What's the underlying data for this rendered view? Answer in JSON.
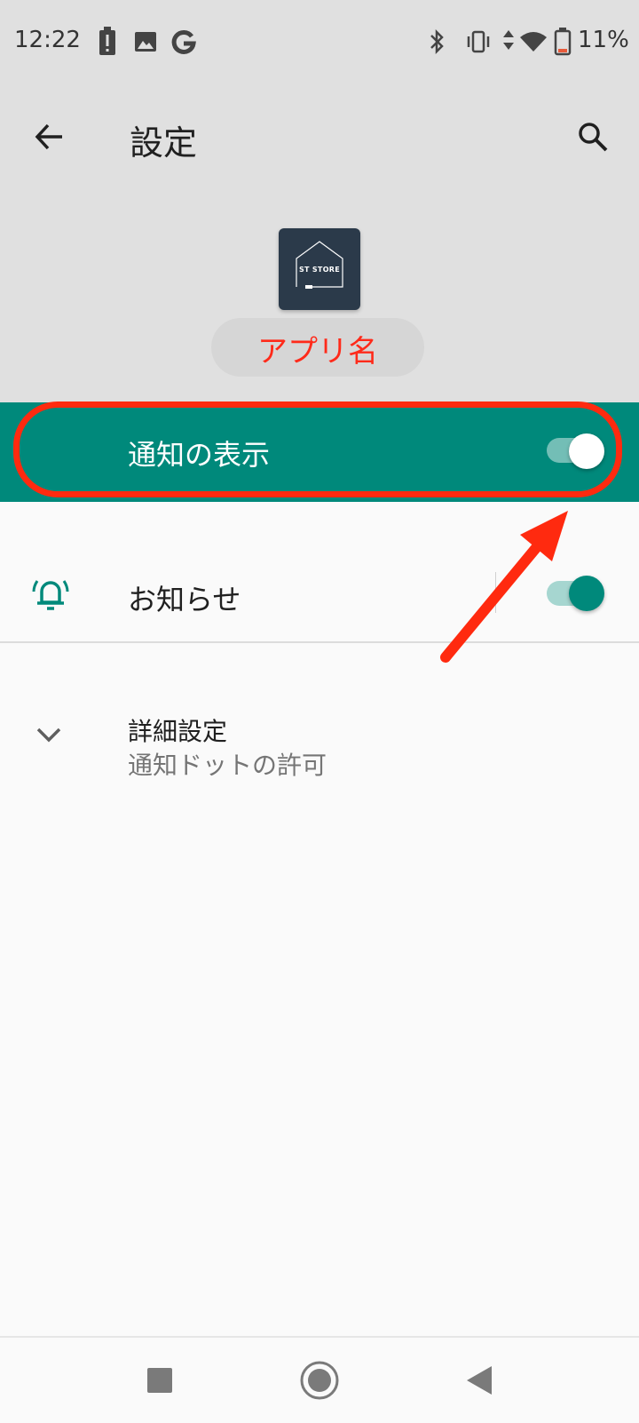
{
  "status_bar": {
    "time": "12:22",
    "battery_percent": "11%",
    "left_icons": [
      "battery-alert-icon",
      "image-icon",
      "google-icon"
    ],
    "right_icons": [
      "bluetooth-icon",
      "vibrate-icon",
      "data-arrows-icon",
      "wifi-icon",
      "battery-icon"
    ]
  },
  "toolbar": {
    "title": "設定",
    "back_icon": "arrow-left-icon",
    "search_icon": "search-icon"
  },
  "app": {
    "icon_text": "ST STORE",
    "name": "アプリ名"
  },
  "settings": {
    "master_toggle": {
      "label": "通知の表示",
      "enabled": true
    },
    "notice": {
      "label": "お知らせ",
      "icon": "bell-ring-icon",
      "enabled": true
    },
    "advanced": {
      "title": "詳細設定",
      "subtitle": "通知ドットの許可",
      "icon": "chevron-down-icon"
    }
  },
  "colors": {
    "accent": "#00897b",
    "header_bg": "#e0e0e0",
    "annotation_red": "#ff2a0f"
  },
  "nav_bar": {
    "icons": [
      "recents-square-icon",
      "home-circle-icon",
      "back-triangle-icon"
    ]
  }
}
